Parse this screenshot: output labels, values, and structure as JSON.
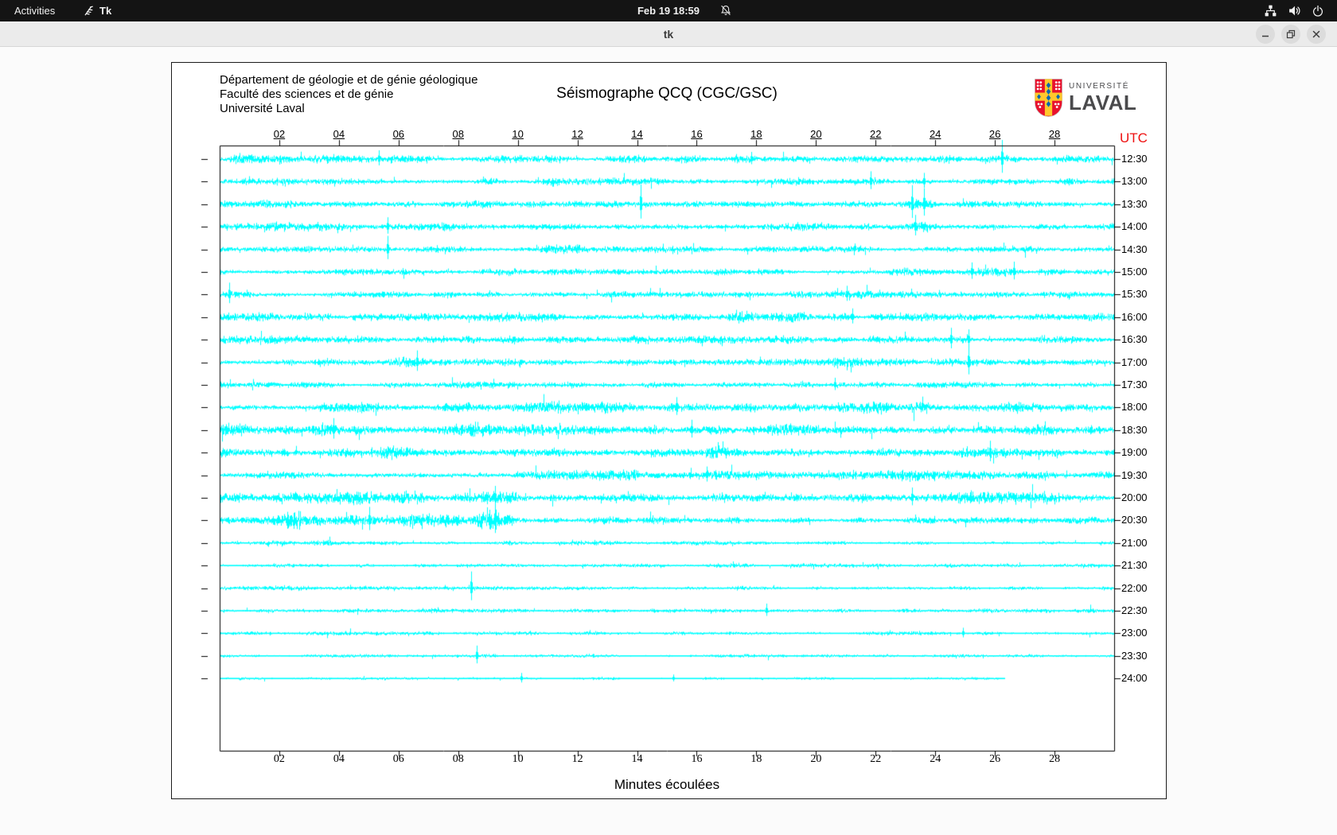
{
  "topbar": {
    "activities": "Activities",
    "app_name": "Tk",
    "clock": "Feb 19 18:59"
  },
  "window": {
    "title": "tk"
  },
  "header": {
    "lines": [
      "Département de géologie et de génie géologique",
      "Faculté des sciences et de génie",
      "Université Laval"
    ],
    "title": "Séismographe QCQ (CGC/GSC)",
    "logo": {
      "top": "UNIVERSITÉ",
      "bottom": "LAVAL",
      "shield_red": "#e8112d",
      "shield_yellow": "#ffc72c",
      "shield_blue": "#0067b1"
    }
  },
  "seismograph": {
    "utc_label": "UTC",
    "utc_color": "#ee1111",
    "trace_color": "#00ffff",
    "xlabel": "Minutes écoulées",
    "x_ticks": [
      "02",
      "04",
      "06",
      "08",
      "10",
      "12",
      "14",
      "16",
      "18",
      "20",
      "22",
      "24",
      "26",
      "28"
    ],
    "x_range_minutes": [
      0,
      30
    ],
    "row_interval_minutes": 30,
    "rows": [
      {
        "label": "12:30",
        "amp": 0.9,
        "end": 30,
        "bursts": [
          [
            0.5,
            4.5,
            1.35
          ],
          [
            5,
            5.8,
            1.5
          ],
          [
            13.5,
            16,
            1.25
          ],
          [
            17.5,
            19,
            1.25
          ]
        ],
        "spikes": [
          [
            5.3,
            11
          ],
          [
            17.8,
            9
          ],
          [
            26.2,
            24
          ]
        ]
      },
      {
        "label": "13:00",
        "amp": 0.85,
        "end": 30,
        "bursts": [
          [
            0.8,
            2,
            1.3
          ],
          [
            11.2,
            11.8,
            1.45
          ],
          [
            14.4,
            15,
            1.35
          ],
          [
            21.5,
            22,
            1.3
          ]
        ],
        "spikes": [
          [
            21.8,
            13
          ],
          [
            23.6,
            11
          ]
        ]
      },
      {
        "label": "13:30",
        "amp": 0.9,
        "end": 30,
        "bursts": [
          [
            2.4,
            3,
            1.35
          ],
          [
            22.8,
            24,
            1.7
          ]
        ],
        "spikes": [
          [
            14.1,
            25
          ],
          [
            23.2,
            24
          ],
          [
            23.6,
            20
          ]
        ]
      },
      {
        "label": "14:00",
        "amp": 0.95,
        "end": 30,
        "bursts": [
          [
            0.5,
            2,
            1.3
          ],
          [
            22.5,
            24,
            1.45
          ]
        ],
        "spikes": [
          [
            5.6,
            12
          ],
          [
            23.3,
            15
          ]
        ]
      },
      {
        "label": "14:30",
        "amp": 0.8,
        "end": 30,
        "bursts": [
          [
            11,
            12,
            1.35
          ]
        ],
        "spikes": [
          [
            5.6,
            17
          ]
        ]
      },
      {
        "label": "15:00",
        "amp": 0.8,
        "end": 30,
        "bursts": [
          [
            22.4,
            26.5,
            1.45
          ]
        ],
        "spikes": [
          [
            25.2,
            12
          ],
          [
            26.6,
            13
          ]
        ]
      },
      {
        "label": "15:30",
        "amp": 0.85,
        "end": 30,
        "bursts": [
          [
            20.4,
            21.5,
            1.35
          ]
        ],
        "spikes": [
          [
            0.3,
            15
          ],
          [
            21,
            11
          ]
        ]
      },
      {
        "label": "16:00",
        "amp": 1.0,
        "end": 30,
        "bursts": [
          [
            0,
            1.5,
            1.25
          ],
          [
            17.3,
            19.5,
            1.8
          ],
          [
            22.9,
            23.6,
            1.5
          ]
        ],
        "spikes": [
          [
            21.2,
            11
          ]
        ]
      },
      {
        "label": "16:30",
        "amp": 1.0,
        "end": 30,
        "bursts": [
          [
            0,
            2,
            1.35
          ],
          [
            16.4,
            17.5,
            1.35
          ],
          [
            24.2,
            24.8,
            1.6
          ]
        ],
        "spikes": [
          [
            24.5,
            15
          ],
          [
            25.1,
            13
          ]
        ]
      },
      {
        "label": "17:00",
        "amp": 0.9,
        "end": 30,
        "bursts": [
          [
            5.9,
            7.5,
            1.45
          ],
          [
            20.4,
            21,
            1.35
          ]
        ],
        "spikes": [
          [
            6.6,
            15
          ],
          [
            25.1,
            21
          ]
        ]
      },
      {
        "label": "17:30",
        "amp": 0.75,
        "end": 30,
        "bursts": [
          [
            7.9,
            9,
            1.3
          ],
          [
            20,
            21,
            1.25
          ]
        ],
        "spikes": [
          [
            20.6,
            9
          ]
        ]
      },
      {
        "label": "18:00",
        "amp": 1.05,
        "end": 30,
        "bursts": [
          [
            4,
            5.5,
            1.45
          ],
          [
            7.5,
            13.5,
            1.35
          ],
          [
            17.5,
            23.5,
            1.55
          ],
          [
            26.4,
            27.5,
            1.45
          ]
        ],
        "spikes": [
          [
            15.3,
            13
          ]
        ]
      },
      {
        "label": "18:30",
        "amp": 1.1,
        "end": 30,
        "bursts": [
          [
            0,
            4.5,
            1.65
          ],
          [
            7.5,
            10.5,
            1.45
          ],
          [
            17.8,
            22.5,
            1.45
          ],
          [
            26.7,
            27.4,
            1.55
          ]
        ],
        "spikes": [
          [
            3.8,
            15
          ],
          [
            15.8,
            13
          ]
        ]
      },
      {
        "label": "19:00",
        "amp": 1.1,
        "end": 30,
        "bursts": [
          [
            0,
            1.5,
            1.45
          ],
          [
            5.4,
            6.5,
            1.35
          ],
          [
            15.9,
            17,
            1.35
          ],
          [
            24.9,
            26.5,
            1.9
          ],
          [
            27,
            28,
            1.5
          ]
        ],
        "spikes": [
          [
            25.8,
            15
          ]
        ]
      },
      {
        "label": "19:30",
        "amp": 0.95,
        "end": 30,
        "bursts": [
          [
            10,
            17,
            1.3
          ],
          [
            21,
            27.5,
            1.4
          ]
        ],
        "spikes": [
          [
            16.3,
            11
          ]
        ]
      },
      {
        "label": "20:00",
        "amp": 1.1,
        "end": 30,
        "bursts": [
          [
            0,
            7,
            1.45
          ],
          [
            8.9,
            9.7,
            1.55
          ],
          [
            22.4,
            28,
            1.6
          ]
        ],
        "spikes": [
          [
            9.2,
            15
          ],
          [
            23.2,
            13
          ]
        ]
      },
      {
        "label": "20:30",
        "amp": 1.15,
        "end": 30,
        "bursts": [
          [
            0,
            2.5,
            1.45
          ],
          [
            2.5,
            9,
            1.9
          ],
          [
            9,
            9.6,
            1.7
          ],
          [
            10,
            30,
            0.78
          ]
        ],
        "spikes": [
          [
            5,
            17
          ],
          [
            9.2,
            22
          ]
        ]
      },
      {
        "label": "21:00",
        "amp": 0.55,
        "end": 30,
        "bursts": [
          [
            3,
            3.6,
            1.5
          ],
          [
            10.4,
            11,
            1.4
          ]
        ],
        "spikes": []
      },
      {
        "label": "21:30",
        "amp": 0.5,
        "end": 30,
        "bursts": [
          [
            1,
            1.6,
            1.3
          ],
          [
            17.4,
            18,
            1.3
          ]
        ],
        "spikes": []
      },
      {
        "label": "22:00",
        "amp": 0.5,
        "end": 30,
        "bursts": [
          [
            2,
            2.6,
            1.3
          ],
          [
            17.6,
            18.2,
            1.35
          ]
        ],
        "spikes": [
          [
            8.4,
            21
          ]
        ]
      },
      {
        "label": "22:30",
        "amp": 0.55,
        "end": 30,
        "bursts": [
          [
            14.4,
            15,
            1.3
          ]
        ],
        "spikes": [
          [
            18.3,
            9
          ]
        ]
      },
      {
        "label": "23:00",
        "amp": 0.5,
        "end": 30,
        "bursts": [
          [
            3.4,
            4.5,
            1.3
          ],
          [
            14.9,
            15.5,
            1.3
          ]
        ],
        "spikes": [
          [
            24.9,
            7
          ]
        ]
      },
      {
        "label": "23:30",
        "amp": 0.45,
        "end": 30,
        "bursts": [
          [
            11.9,
            12.5,
            1.25
          ]
        ],
        "spikes": [
          [
            8.6,
            13
          ]
        ]
      },
      {
        "label": "24:00",
        "amp": 0.35,
        "end": 26.3,
        "bursts": [],
        "spikes": [
          [
            10.1,
            7
          ],
          [
            15.2,
            5
          ]
        ]
      }
    ]
  }
}
